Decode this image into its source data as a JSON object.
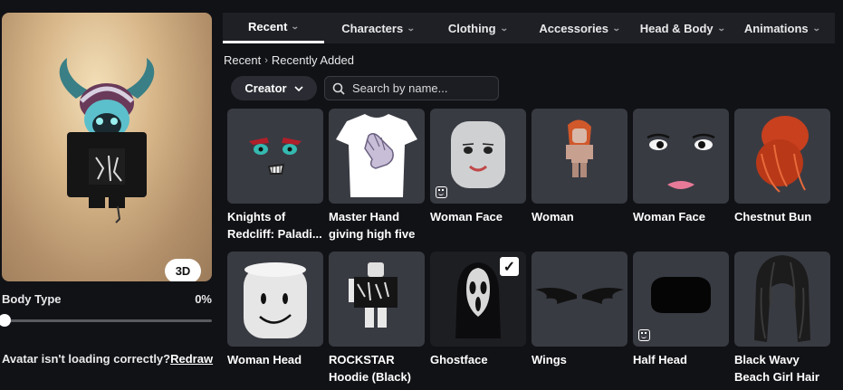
{
  "avatar": {
    "view_button": "3D"
  },
  "body_type": {
    "label": "Body Type",
    "value": "0%",
    "level": 0
  },
  "redraw": {
    "message": "Avatar isn't loading correctly?",
    "link": "Redraw"
  },
  "tabs": [
    {
      "label": "Recent",
      "active": true
    },
    {
      "label": "Characters",
      "active": false
    },
    {
      "label": "Clothing",
      "active": false
    },
    {
      "label": "Accessories",
      "active": false
    },
    {
      "label": "Head & Body",
      "active": false
    },
    {
      "label": "Animations",
      "active": false
    }
  ],
  "breadcrumb": {
    "root": "Recent",
    "current": "Recently Added"
  },
  "filters": {
    "creator_label": "Creator",
    "search_placeholder": "Search by name..."
  },
  "items": [
    {
      "name": "Knights of Redcliff: Paladi...",
      "icon": "face-paladin"
    },
    {
      "name": "Master Hand giving high five",
      "icon": "tshirt"
    },
    {
      "name": "Woman Face",
      "icon": "head",
      "badge": "face-badge"
    },
    {
      "name": "Woman",
      "icon": "woman-character"
    },
    {
      "name": "Woman Face",
      "icon": "woman-face"
    },
    {
      "name": "Chestnut Bun",
      "icon": "hair"
    },
    {
      "name": "Woman Head",
      "icon": "head"
    },
    {
      "name": "ROCKSTAR Hoodie (Black)",
      "icon": "hoodie"
    },
    {
      "name": "Ghostface",
      "icon": "ghost-mask",
      "selected": true
    },
    {
      "name": "Wings",
      "icon": "wings"
    },
    {
      "name": "Half Head",
      "icon": "half-head",
      "badge": "face-badge"
    },
    {
      "name": "Black Wavy Beach Girl Hair",
      "icon": "hair"
    }
  ]
}
